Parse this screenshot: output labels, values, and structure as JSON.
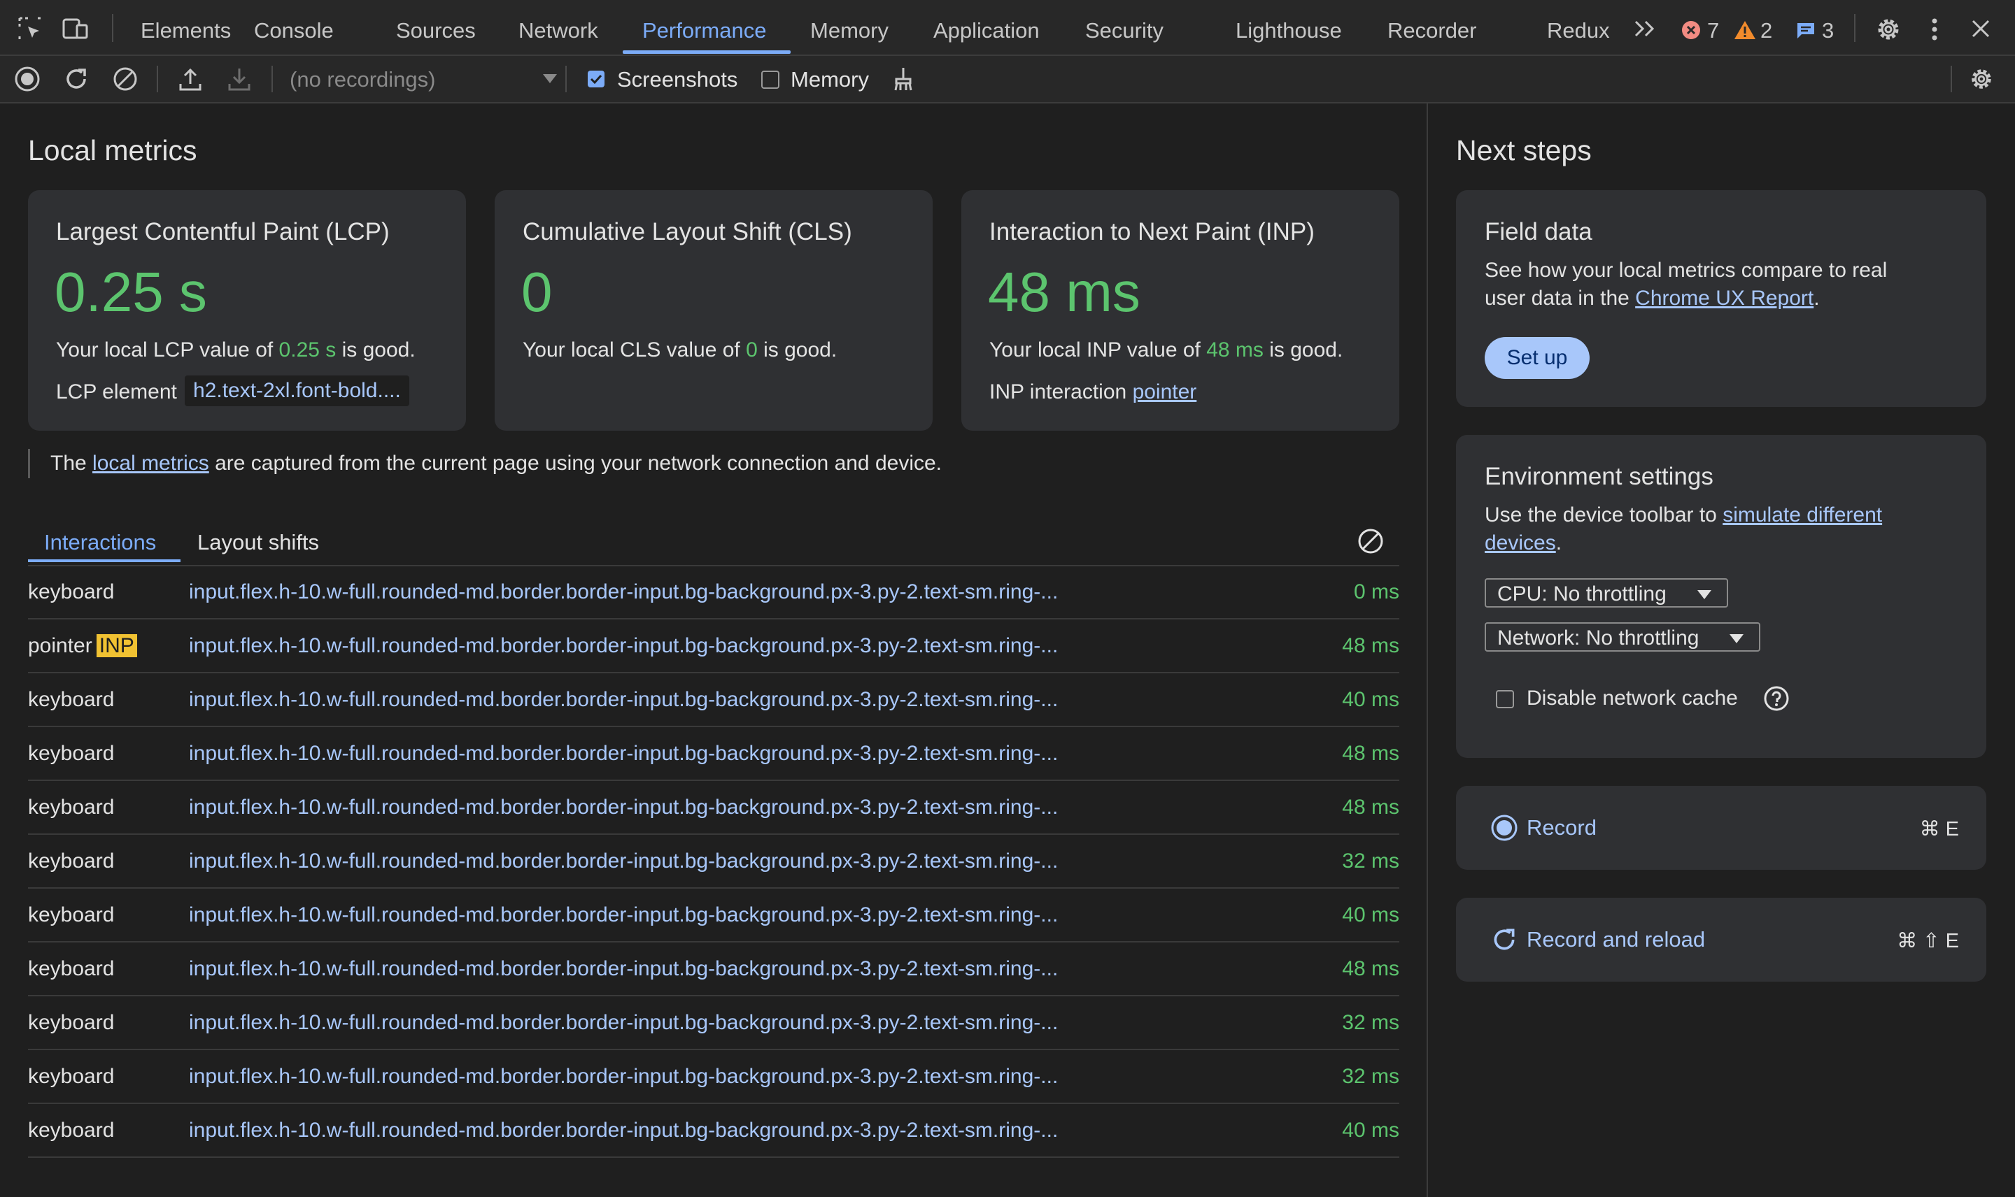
{
  "tabs": [
    "Elements",
    "Console",
    "Sources",
    "Network",
    "Performance",
    "Memory",
    "Application",
    "Security",
    "Lighthouse",
    "Recorder",
    "Redux"
  ],
  "active_tab": "Performance",
  "status": {
    "errors": "7",
    "warnings": "2",
    "messages": "3"
  },
  "toolbar": {
    "recordings_placeholder": "(no recordings)",
    "screenshots_label": "Screenshots",
    "screenshots_checked": true,
    "memory_label": "Memory",
    "memory_checked": false
  },
  "local_metrics": {
    "heading": "Local metrics",
    "lcp": {
      "title": "Largest Contentful Paint (LCP)",
      "value": "0.25 s",
      "desc_prefix": "Your local LCP value of ",
      "desc_value": "0.25 s",
      "desc_suffix": " is good.",
      "element_label": "LCP element",
      "element_value": "h2.text-2xl.font-bold...."
    },
    "cls": {
      "title": "Cumulative Layout Shift (CLS)",
      "value": "0",
      "desc_prefix": "Your local CLS value of ",
      "desc_value": "0",
      "desc_suffix": " is good."
    },
    "inp": {
      "title": "Interaction to Next Paint (INP)",
      "value": "48 ms",
      "desc_prefix": "Your local INP value of ",
      "desc_value": "48 ms",
      "desc_suffix": " is good.",
      "interaction_label": "INP interaction",
      "interaction_value": "pointer"
    },
    "note_prefix": "The ",
    "note_link": "local metrics",
    "note_suffix": " are captured from the current page using your network connection and device."
  },
  "interactions": {
    "tabs": [
      "Interactions",
      "Layout shifts"
    ],
    "active_tab": "Interactions",
    "inp_badge": "INP",
    "rows": [
      {
        "type": "keyboard",
        "selector": "input.flex.h-10.w-full.rounded-md.border.border-input.bg-background.px-3.py-2.text-sm.ring-...",
        "duration": "0 ms"
      },
      {
        "type": "pointer",
        "selector": "input.flex.h-10.w-full.rounded-md.border.border-input.bg-background.px-3.py-2.text-sm.ring-...",
        "duration": "48 ms"
      },
      {
        "type": "keyboard",
        "selector": "input.flex.h-10.w-full.rounded-md.border.border-input.bg-background.px-3.py-2.text-sm.ring-...",
        "duration": "40 ms"
      },
      {
        "type": "keyboard",
        "selector": "input.flex.h-10.w-full.rounded-md.border.border-input.bg-background.px-3.py-2.text-sm.ring-...",
        "duration": "48 ms"
      },
      {
        "type": "keyboard",
        "selector": "input.flex.h-10.w-full.rounded-md.border.border-input.bg-background.px-3.py-2.text-sm.ring-...",
        "duration": "48 ms"
      },
      {
        "type": "keyboard",
        "selector": "input.flex.h-10.w-full.rounded-md.border.border-input.bg-background.px-3.py-2.text-sm.ring-...",
        "duration": "32 ms"
      },
      {
        "type": "keyboard",
        "selector": "input.flex.h-10.w-full.rounded-md.border.border-input.bg-background.px-3.py-2.text-sm.ring-...",
        "duration": "40 ms"
      },
      {
        "type": "keyboard",
        "selector": "input.flex.h-10.w-full.rounded-md.border.border-input.bg-background.px-3.py-2.text-sm.ring-...",
        "duration": "48 ms"
      },
      {
        "type": "keyboard",
        "selector": "input.flex.h-10.w-full.rounded-md.border.border-input.bg-background.px-3.py-2.text-sm.ring-...",
        "duration": "32 ms"
      },
      {
        "type": "keyboard",
        "selector": "input.flex.h-10.w-full.rounded-md.border.border-input.bg-background.px-3.py-2.text-sm.ring-...",
        "duration": "32 ms"
      },
      {
        "type": "keyboard",
        "selector": "input.flex.h-10.w-full.rounded-md.border.border-input.bg-background.px-3.py-2.text-sm.ring-...",
        "duration": "40 ms"
      }
    ]
  },
  "next_steps": {
    "heading": "Next steps",
    "field_data": {
      "title": "Field data",
      "line1": "See how your local metrics compare to real",
      "line2_prefix": "user data in the ",
      "line2_link": "Chrome UX Report",
      "line2_suffix": ".",
      "button": "Set up"
    },
    "environment": {
      "title": "Environment settings",
      "line1_prefix": "Use the device toolbar to ",
      "line1_link": "simulate different",
      "line2_link": "devices",
      "line2_suffix": ".",
      "cpu": "CPU: No throttling",
      "network": "Network: No throttling",
      "disable_cache": "Disable network cache",
      "disable_cache_checked": false
    },
    "record": {
      "label": "Record",
      "shortcut": "⌘ E"
    },
    "record_reload": {
      "label": "Record and reload",
      "shortcut": "⌘ ⇧ E"
    }
  },
  "colors": {
    "accent": "#7cacf8",
    "good": "#5cc46e",
    "link": "#a8c7fa",
    "error": "#f28b82",
    "warning": "#fdd663",
    "inp_badge": "#f1c232"
  }
}
